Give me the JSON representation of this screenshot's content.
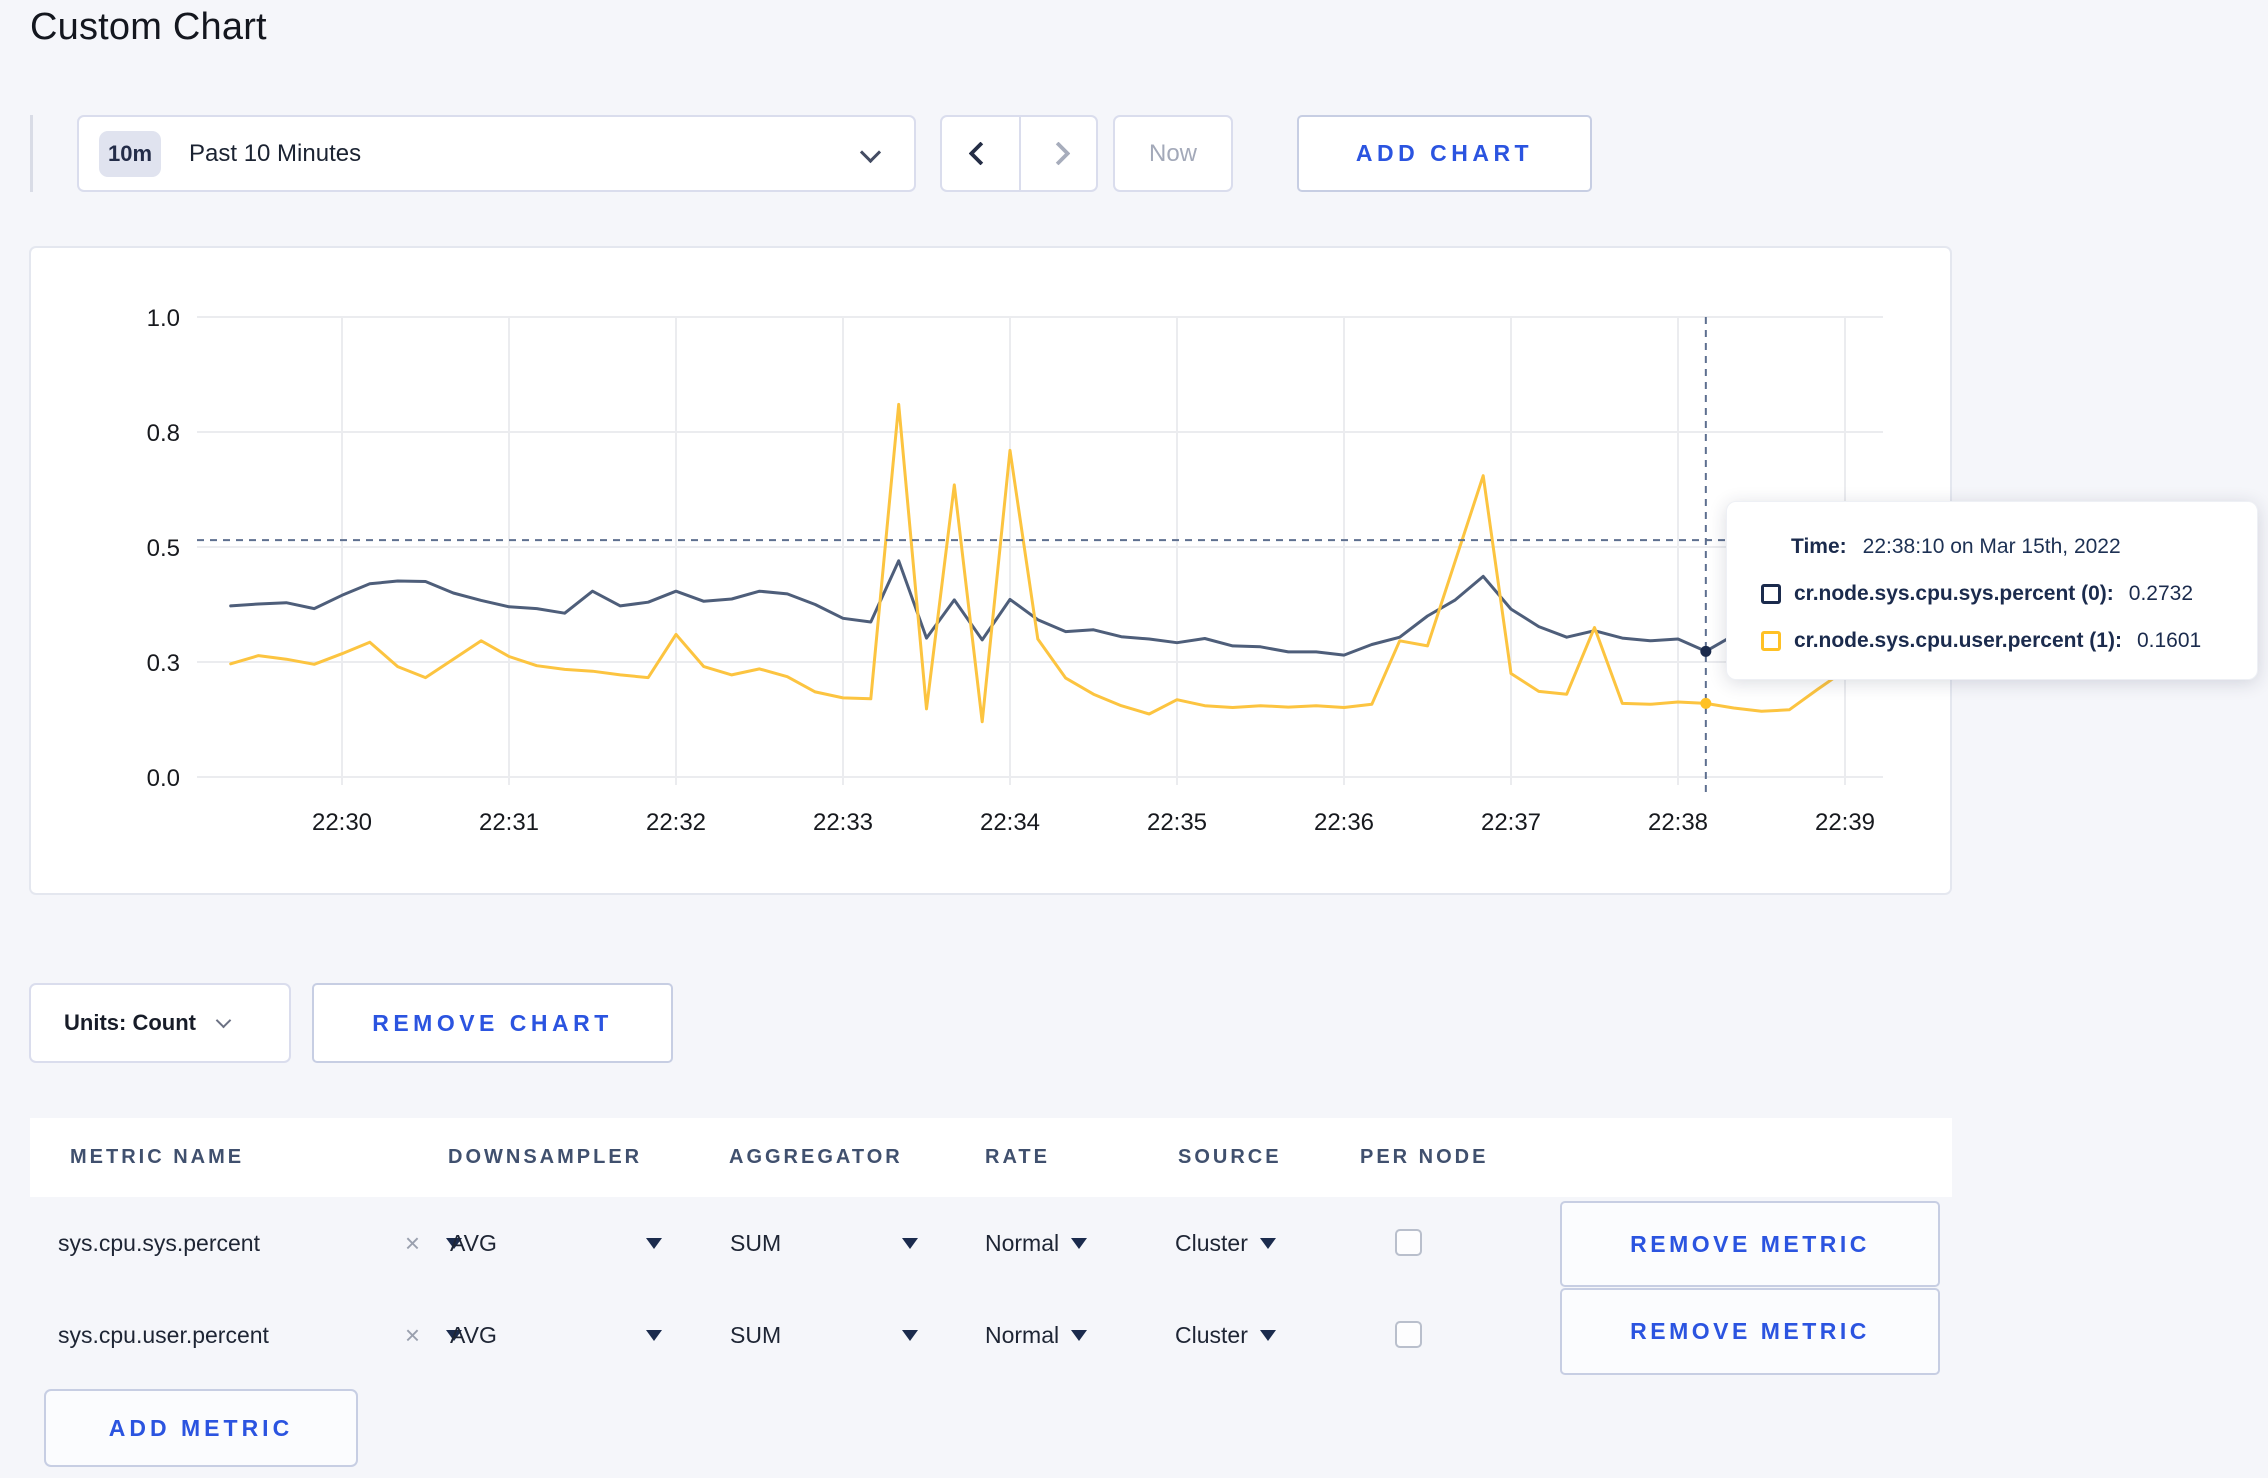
{
  "page": {
    "title": "Custom Chart",
    "background": "#f5f6fa"
  },
  "toolbar": {
    "range_badge": "10m",
    "range_label": "Past 10 Minutes",
    "now_label": "Now",
    "add_chart_label": "ADD CHART"
  },
  "chart_data": {
    "type": "line",
    "title": "",
    "xlabel": "",
    "ylabel": "",
    "ylim": [
      0,
      1
    ],
    "grid": true,
    "x_ticks": [
      "22:30",
      "22:31",
      "22:32",
      "22:33",
      "22:34",
      "22:35",
      "22:36",
      "22:37",
      "22:38",
      "22:39"
    ],
    "y_ticks": [
      {
        "value": 0.0,
        "label": "0.0"
      },
      {
        "value": 0.25,
        "label": "0.3"
      },
      {
        "value": 0.5,
        "label": "0.5"
      },
      {
        "value": 0.75,
        "label": "0.8"
      },
      {
        "value": 1.0,
        "label": "1.0"
      }
    ],
    "x_start_offset_sec": -40,
    "x_step_sec": 10,
    "series": [
      {
        "name": "cr.node.sys.cpu.sys.percent (0)",
        "color": "#4e5e7a",
        "swatch": "#1b2b4d",
        "values": [
          0.372,
          0.376,
          0.379,
          0.366,
          0.395,
          0.42,
          0.426,
          0.425,
          0.4,
          0.384,
          0.37,
          0.366,
          0.356,
          0.404,
          0.372,
          0.38,
          0.404,
          0.382,
          0.387,
          0.404,
          0.398,
          0.375,
          0.345,
          0.337,
          0.47,
          0.302,
          0.385,
          0.298,
          0.386,
          0.342,
          0.316,
          0.32,
          0.305,
          0.3,
          0.292,
          0.301,
          0.285,
          0.283,
          0.272,
          0.272,
          0.265,
          0.288,
          0.304,
          0.35,
          0.385,
          0.436,
          0.365,
          0.327,
          0.304,
          0.318,
          0.302,
          0.296,
          0.3,
          0.2732,
          0.308,
          0.324,
          0.306,
          0.296,
          0.302,
          0.306
        ]
      },
      {
        "name": "cr.node.sys.cpu.user.percent (1)",
        "color": "#fcc440",
        "swatch": "#ffc125",
        "values": [
          0.246,
          0.264,
          0.256,
          0.245,
          0.268,
          0.293,
          0.24,
          0.216,
          0.256,
          0.296,
          0.262,
          0.242,
          0.234,
          0.23,
          0.222,
          0.216,
          0.31,
          0.24,
          0.222,
          0.235,
          0.218,
          0.185,
          0.172,
          0.17,
          0.81,
          0.148,
          0.635,
          0.12,
          0.71,
          0.3,
          0.215,
          0.18,
          0.155,
          0.137,
          0.168,
          0.155,
          0.151,
          0.155,
          0.152,
          0.155,
          0.151,
          0.158,
          0.296,
          0.285,
          0.47,
          0.655,
          0.225,
          0.186,
          0.18,
          0.325,
          0.16,
          0.158,
          0.163,
          0.1601,
          0.15,
          0.143,
          0.146,
          0.19,
          0.232,
          0.272
        ]
      }
    ],
    "crosshair": {
      "time_offset_sec": 490,
      "time_text": "22:38:10",
      "mouse_y_value": 0.515,
      "point_values": [
        0.2732,
        0.1601
      ]
    },
    "legend_position": "tooltip"
  },
  "tooltip": {
    "time_label": "Time:",
    "time_value": "22:38:10 on Mar 15th, 2022",
    "entries": [
      {
        "name": "cr.node.sys.cpu.sys.percent (0):",
        "value": "0.2732",
        "swatch_color": "#1b2b4d"
      },
      {
        "name": "cr.node.sys.cpu.user.percent (1):",
        "value": "0.1601",
        "swatch_color": "#ffc125"
      }
    ]
  },
  "chart_controls": {
    "units_label": "Units: Count",
    "remove_chart_label": "REMOVE CHART"
  },
  "metrics_table": {
    "headers": [
      "METRIC NAME",
      "DOWNSAMPLER",
      "AGGREGATOR",
      "RATE",
      "SOURCE",
      "PER NODE"
    ],
    "rows": [
      {
        "metric": "sys.cpu.sys.percent",
        "downsampler": "AVG",
        "aggregator": "SUM",
        "rate": "Normal",
        "source": "Cluster",
        "per_node_checked": false,
        "remove_label": "REMOVE METRIC"
      },
      {
        "metric": "sys.cpu.user.percent",
        "downsampler": "AVG",
        "aggregator": "SUM",
        "rate": "Normal",
        "source": "Cluster",
        "per_node_checked": false,
        "remove_label": "REMOVE METRIC"
      }
    ],
    "add_metric_label": "ADD METRIC"
  },
  "colors": {
    "accent_blue": "#2b54e0",
    "navy_text": "#1b2b4d",
    "page_bg": "#f5f6fa",
    "grid": "#ebecef",
    "crosshair": "#5d6f8f"
  }
}
